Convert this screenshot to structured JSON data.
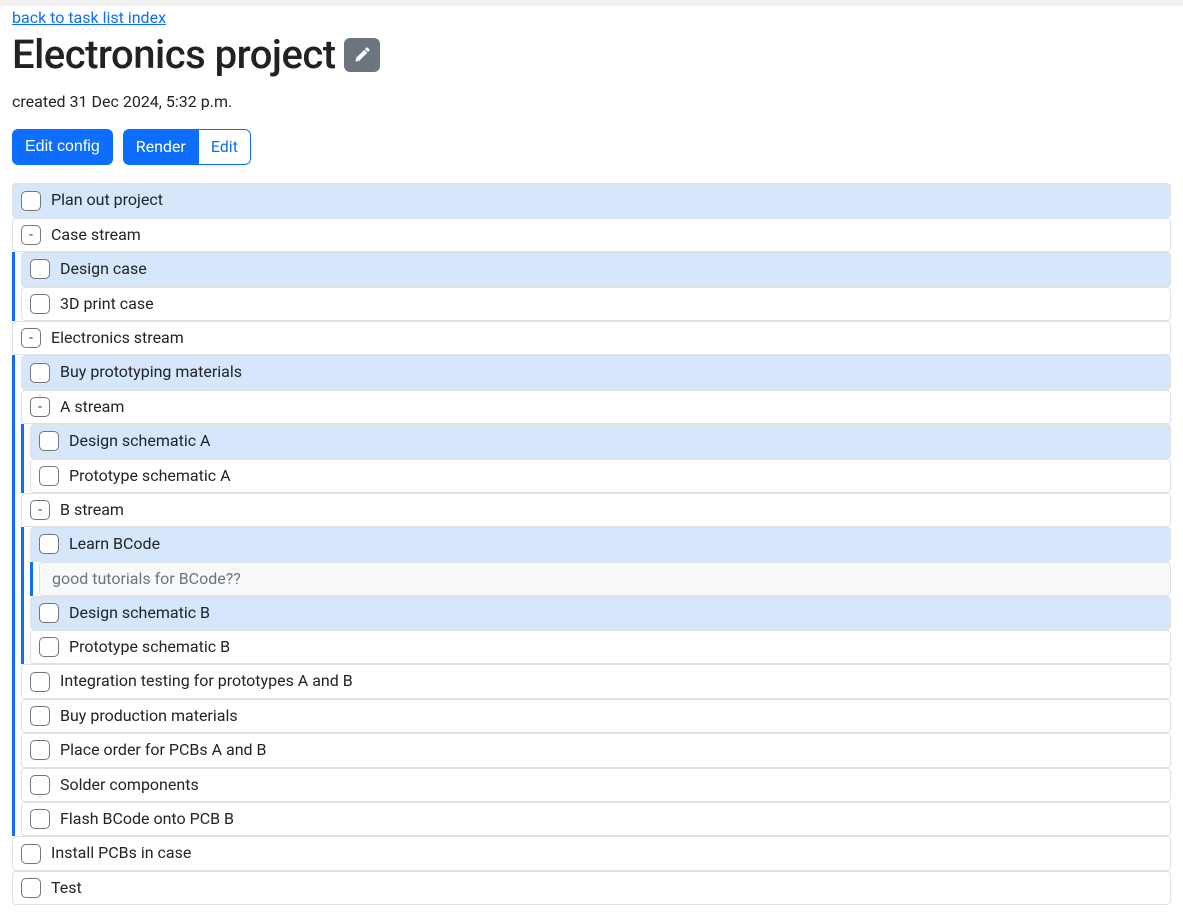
{
  "nav": {
    "back_link": "back to task list index"
  },
  "header": {
    "title": "Electronics project",
    "created_label": "created 31 Dec 2024, 5:32 p.m."
  },
  "buttons": {
    "edit_config": "Edit config",
    "render": "Render",
    "edit": "Edit"
  },
  "tasks": [
    {
      "kind": "task",
      "label": "Plan out project",
      "highlight": true
    },
    {
      "kind": "stream",
      "label": "Case stream",
      "children": [
        {
          "kind": "task",
          "label": "Design case",
          "highlight": true
        },
        {
          "kind": "task",
          "label": "3D print case"
        }
      ]
    },
    {
      "kind": "stream",
      "label": "Electronics stream",
      "children": [
        {
          "kind": "task",
          "label": "Buy prototyping materials",
          "highlight": true
        },
        {
          "kind": "stream",
          "label": "A stream",
          "children": [
            {
              "kind": "task",
              "label": "Design schematic A",
              "highlight": true
            },
            {
              "kind": "task",
              "label": "Prototype schematic A"
            }
          ]
        },
        {
          "kind": "stream",
          "label": "B stream",
          "children": [
            {
              "kind": "task",
              "label": "Learn BCode",
              "highlight": true,
              "children": [
                {
                  "kind": "note",
                  "label": "good tutorials for BCode??"
                }
              ]
            },
            {
              "kind": "task",
              "label": "Design schematic B",
              "highlight": true
            },
            {
              "kind": "task",
              "label": "Prototype schematic B"
            }
          ]
        },
        {
          "kind": "task",
          "label": "Integration testing for prototypes A and B"
        },
        {
          "kind": "task",
          "label": "Buy production materials"
        },
        {
          "kind": "task",
          "label": "Place order for PCBs A and B"
        },
        {
          "kind": "task",
          "label": "Solder components"
        },
        {
          "kind": "task",
          "label": "Flash BCode onto PCB B"
        }
      ]
    },
    {
      "kind": "task",
      "label": "Install PCBs in case"
    },
    {
      "kind": "task",
      "label": "Test"
    }
  ]
}
